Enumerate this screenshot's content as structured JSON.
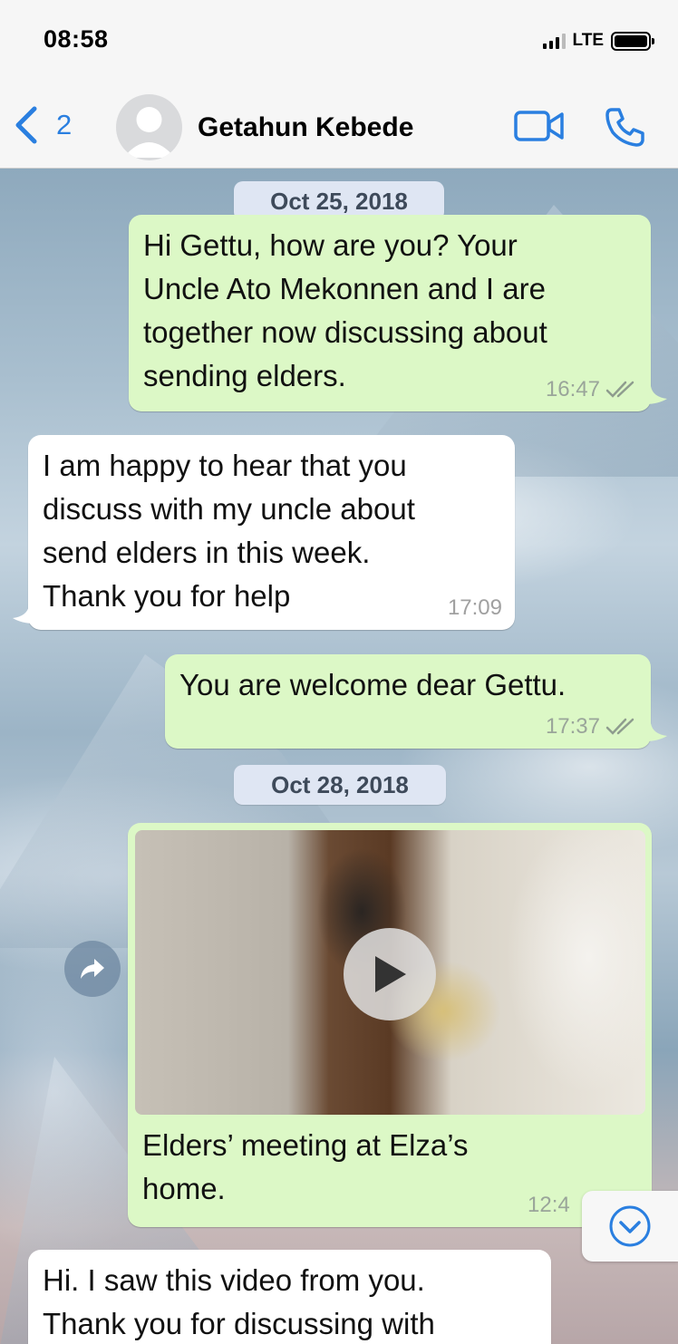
{
  "status_bar": {
    "time": "08:58",
    "network": "LTE"
  },
  "header": {
    "back_count": "2",
    "contact_name": "Getahun Kebede",
    "icons": {
      "back": "chevron-left-icon",
      "avatar": "person-icon",
      "video": "video-camera-icon",
      "call": "phone-icon"
    },
    "accent_color": "#2a7fe0"
  },
  "chat": {
    "date_1": "Oct 25, 2018",
    "date_2": "Oct 28, 2018",
    "messages": [
      {
        "direction": "outgoing",
        "lines": [
          "Hi Gettu, how are you? Your",
          "Uncle Ato Mekonnen and I are",
          "together now discussing about",
          "sending elders."
        ],
        "time": "16:47",
        "status": "read"
      },
      {
        "direction": "incoming",
        "lines": [
          "I am happy to hear that you",
          "discuss with my uncle about",
          "send elders in this week.",
          "Thank you for help"
        ],
        "time": "17:09"
      },
      {
        "direction": "outgoing",
        "lines": [
          "You are welcome dear Gettu."
        ],
        "time": "17:37",
        "status": "read"
      },
      {
        "direction": "outgoing",
        "type": "video",
        "caption_lines": [
          "Elders’ meeting at Elza’s",
          "home."
        ],
        "time": "12:4"
      },
      {
        "direction": "incoming",
        "lines": [
          "Hi. I saw this video from you.",
          "Thank you for discussing with"
        ]
      }
    ],
    "colors": {
      "outgoing_bubble": "#dcf8c6",
      "incoming_bubble": "#ffffff",
      "date_chip": "#dfe6f3"
    }
  }
}
